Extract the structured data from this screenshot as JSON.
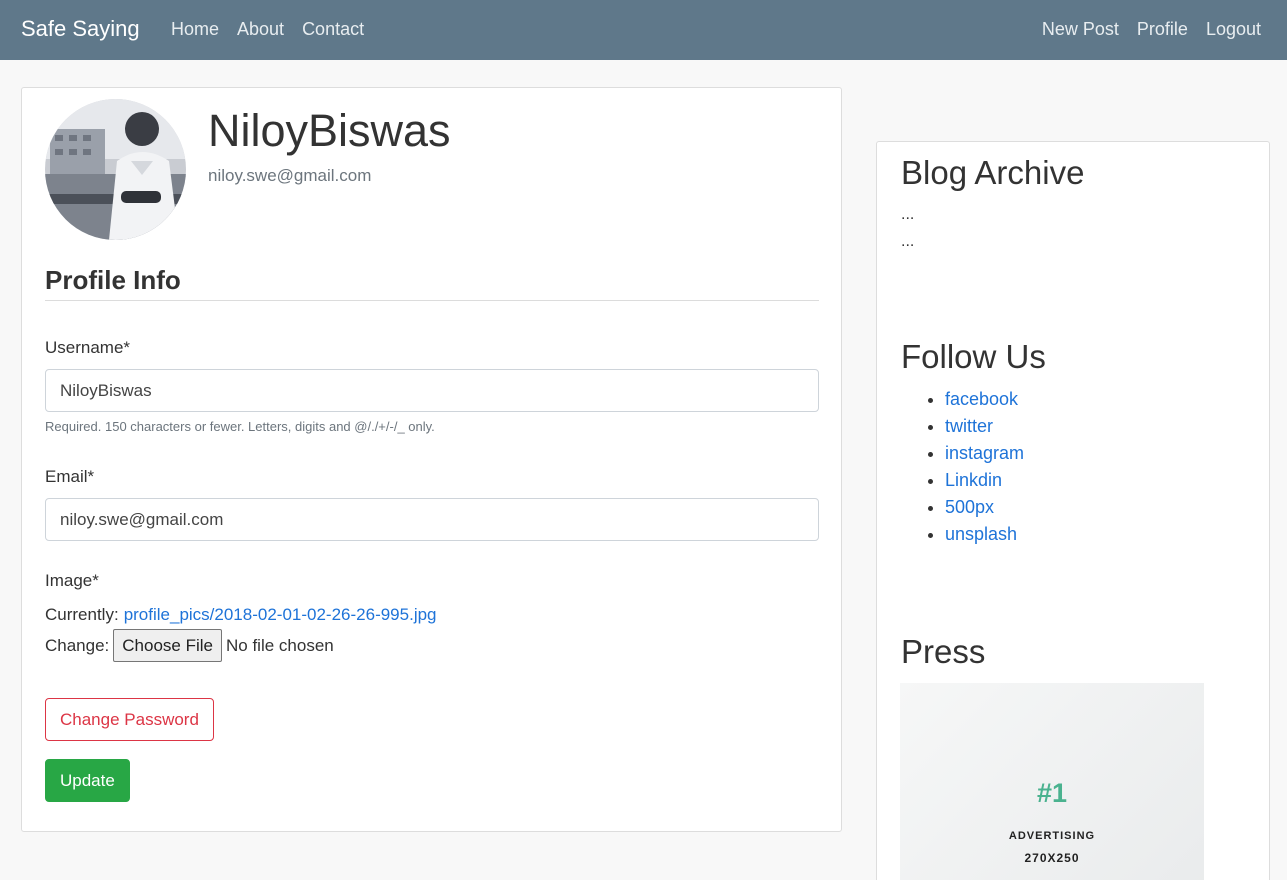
{
  "navbar": {
    "brand": "Safe Saying",
    "left_links": [
      "Home",
      "About",
      "Contact"
    ],
    "right_links": [
      "New Post",
      "Profile",
      "Logout"
    ]
  },
  "profile": {
    "username": "NiloyBiswas",
    "email": "niloy.swe@gmail.com",
    "section_title": "Profile Info"
  },
  "form": {
    "username_label": "Username*",
    "username_value": "NiloyBiswas",
    "username_help": "Required. 150 characters or fewer. Letters, digits and @/./+/-/_ only.",
    "email_label": "Email*",
    "email_value": "niloy.swe@gmail.com",
    "image_label": "Image*",
    "currently_label": "Currently:",
    "current_file": "profile_pics/2018-02-01-02-26-26-995.jpg",
    "change_label": "Change:",
    "choose_file_label": "Choose File",
    "no_file_text": "No file chosen",
    "change_password_label": "Change Password",
    "update_label": "Update"
  },
  "sidebar": {
    "archive_title": "Blog Archive",
    "archive_items": [
      "...",
      "..."
    ],
    "follow_title": "Follow Us",
    "follow_links": [
      "facebook",
      "twitter",
      "instagram",
      "Linkdin",
      "500px",
      "unsplash"
    ],
    "press_title": "Press",
    "ad": {
      "rank": "#1",
      "line1": "ADVERTISING",
      "line2": "270X250"
    }
  },
  "colors": {
    "navbar_bg": "#5f788a",
    "link": "#1e73d8",
    "danger": "#dc3545",
    "success": "#28a745",
    "ad_accent": "#4ab28f"
  }
}
